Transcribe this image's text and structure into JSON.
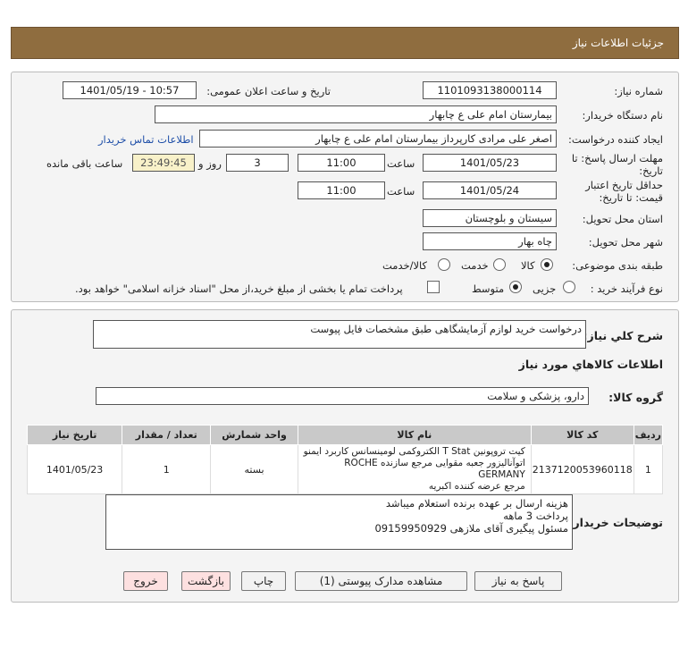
{
  "header": {
    "title": "جزئیات اطلاعات نیاز"
  },
  "form": {
    "need_number_label": "شماره نیاز:",
    "need_number": "1101093138000114",
    "announce_label": "تاریخ و ساعت اعلان عمومی:",
    "announce_value": "1401/05/19 - 10:57",
    "buyer_org_label": "نام دستگاه خریدار:",
    "buyer_org": "بیمارستان امام علی  ع  چابهار",
    "requester_label": "ایجاد کننده درخواست:",
    "requester": "اصغر علی مرادی کارپرداز بیمارستان امام علی  ع  چابهار",
    "contact_link": "اطلاعات تماس خریدار",
    "deadline_label_1": "مهلت ارسال پاسخ: تا",
    "deadline_label_2": "تاریخ:",
    "deadline_date": "1401/05/23",
    "time_label": "ساعت",
    "deadline_time": "11:00",
    "days_value": "3",
    "days_label": "روز و",
    "remaining_value": "23:49:45",
    "remaining_label": "ساعت باقی مانده",
    "validity_label_1": "حداقل تاریخ اعتبار",
    "validity_label_2": "قیمت: تا تاریخ:",
    "validity_date": "1401/05/24",
    "validity_time": "11:00",
    "province_label": "استان محل تحویل:",
    "province": "سیستان و بلوچستان",
    "city_label": "شهر محل تحویل:",
    "city": "چاه بهار",
    "category_label": "طبقه بندی موضوعی:",
    "category_options": [
      "کالا",
      "خدمت",
      "کالا/خدمت"
    ],
    "process_label": "نوع فرآیند خرید :",
    "process_options": [
      "جزیی",
      "متوسط"
    ],
    "payment_note": "پرداخت تمام یا بخشی از مبلغ خرید،از محل \"اسناد خزانه اسلامی\" خواهد بود."
  },
  "details": {
    "summary_label": "شرح کلي نياز:",
    "summary": "درخواست خرید لوازم آزمایشگاهی طبق مشخصات فایل پیوست",
    "goods_info_title": "اطلاعات کالاهاي مورد نياز",
    "goods_group_label": "گروه کالا:",
    "goods_group": "دارو، پزشکی و سلامت",
    "table_headers": [
      "ردیف",
      "کد کالا",
      "نام کالا",
      "واحد شمارش",
      "تعداد / مقدار",
      "تاریخ نیاز"
    ],
    "rows": [
      {
        "index": "1",
        "code": "2137120053960118",
        "name_line1": "کیت تروپونین T Stat الکتروکمی لومینسانس کاربرد ایمنو",
        "name_line2": "اتوآنالیزور جعبه مقوایی مرجع سازنده ROCHE GERMANY",
        "name_line3": "مرجع عرضه کننده اکبریه",
        "unit": "بسته",
        "qty": "1",
        "date": "1401/05/23"
      }
    ],
    "buyer_notes_label": "توضیحات خریدار:",
    "buyer_notes": [
      "هزینه ارسال بر عهده برنده استعلام میباشد",
      "پرداخت 3 ماهه",
      "مسئول پیگیری آقای ملازهی 09159950929"
    ]
  },
  "buttons": {
    "reply": "پاسخ به نیاز",
    "docs": "مشاهده مدارک پیوستی (1)",
    "print": "چاپ",
    "back": "بازگشت",
    "exit": "خروج"
  }
}
